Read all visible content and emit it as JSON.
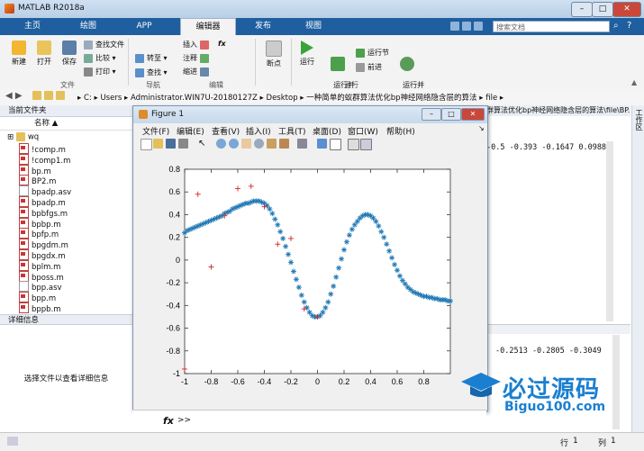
{
  "window": {
    "title": "MATLAB R2018a"
  },
  "tabs": [
    "主页",
    "绘图",
    "APP",
    "编辑器",
    "发布",
    "视图"
  ],
  "search": {
    "placeholder": "搜索文档"
  },
  "ribbon": {
    "file": {
      "new": "新建",
      "open": "打开",
      "save": "保存",
      "find_files": "查找文件",
      "compare": "比较",
      "print": "打印",
      "label": "文件"
    },
    "nav": {
      "insert": "插入",
      "comment": "注释",
      "indent": "缩进",
      "goto": "转至",
      "find": "查找",
      "label": "导航"
    },
    "edit": {
      "fx": "fx",
      "label": "编辑"
    },
    "breakpoints": {
      "breakpoint": "断点",
      "label": "断点"
    },
    "run": {
      "run": "运行",
      "run_advance": "运行并\n前进",
      "run_section": "运行节",
      "advance": "前进",
      "run_time": "运行并\n计时",
      "label": "运行"
    }
  },
  "address": {
    "path": [
      "C:",
      "Users",
      "Administrator.WIN7U-20180127Z",
      "Desktop",
      "一种简单的蚁群算法优化bp神经网络隐含层的算法",
      "file"
    ]
  },
  "left_panel": {
    "title": "当前文件夹",
    "column": "名称",
    "folder": "wq",
    "files": [
      "!comp.m",
      "!comp1.m",
      "bp.m",
      "BP2.m",
      "bpadp.asv",
      "bpadp.m",
      "bpbfgs.m",
      "bpbp.m",
      "bpfp.m",
      "bpgdm.m",
      "bpgdx.m",
      "bplm.m",
      "bposs.m",
      "bpp.asv",
      "bpp.m",
      "bppb.m"
    ],
    "file_types": [
      "m",
      "m",
      "m",
      "m",
      "asv",
      "m",
      "m",
      "m",
      "m",
      "m",
      "m",
      "m",
      "m",
      "asv",
      "m",
      "m"
    ],
    "details_title": "详细信息",
    "details_hint": "选择文件以查看详细信息"
  },
  "right_panel": {
    "header_path": "群算法优化bp神经网络隐含层的算法\\file\\BP...",
    "side_label": "工作区",
    "row1": "-0.5  -0.393  -0.1647  0.0988",
    "row2": "-0.2513    -0.2805    -0.3049"
  },
  "figure": {
    "title": "Figure 1",
    "menu": [
      "文件(F)",
      "编辑(E)",
      "查看(V)",
      "插入(I)",
      "工具(T)",
      "桌面(D)",
      "窗口(W)",
      "帮助(H)"
    ]
  },
  "command": {
    "prompt": ">>",
    "fx": "fx"
  },
  "status": {
    "row_label": "行",
    "row": "1",
    "col_label": "列",
    "col": "1"
  },
  "watermark": {
    "text": "必过源码",
    "url": "Biguo100.com"
  },
  "colors": {
    "accent": "#1f5f9f",
    "net": "#1f77b4",
    "target": "#d62728"
  },
  "chart_data": {
    "type": "scatter",
    "xlim": [
      -1,
      1
    ],
    "ylim": [
      -1,
      0.8
    ],
    "xticks": [
      "-1",
      "-0.8",
      "-0.6",
      "-0.4",
      "-0.2",
      "0",
      "0.2",
      "0.4",
      "0.6",
      "0.8"
    ],
    "yticks": [
      "0.8",
      "0.6",
      "0.4",
      "0.2",
      "0",
      "-0.2",
      "-0.4",
      "-0.6",
      "-0.8",
      "-1"
    ],
    "grid": false,
    "series": [
      {
        "marker": "*",
        "color": "#1f77b4",
        "x": [
          -1,
          -0.98,
          -0.96,
          -0.94,
          -0.92,
          -0.9,
          -0.88,
          -0.86,
          -0.84,
          -0.82,
          -0.8,
          -0.78,
          -0.76,
          -0.74,
          -0.72,
          -0.7,
          -0.68,
          -0.66,
          -0.64,
          -0.62,
          -0.6,
          -0.58,
          -0.56,
          -0.54,
          -0.52,
          -0.5,
          -0.48,
          -0.46,
          -0.44,
          -0.42,
          -0.4,
          -0.38,
          -0.36,
          -0.34,
          -0.32,
          -0.3,
          -0.28,
          -0.26,
          -0.24,
          -0.22,
          -0.2,
          -0.18,
          -0.16,
          -0.14,
          -0.12,
          -0.1,
          -0.08,
          -0.06,
          -0.04,
          -0.02,
          0,
          0.02,
          0.04,
          0.06,
          0.08,
          0.1,
          0.12,
          0.14,
          0.16,
          0.18,
          0.2,
          0.22,
          0.24,
          0.26,
          0.28,
          0.3,
          0.32,
          0.34,
          0.36,
          0.38,
          0.4,
          0.42,
          0.44,
          0.46,
          0.48,
          0.5,
          0.52,
          0.54,
          0.56,
          0.58,
          0.6,
          0.62,
          0.64,
          0.66,
          0.68,
          0.7,
          0.72,
          0.74,
          0.76,
          0.78,
          0.8,
          0.82,
          0.84,
          0.86,
          0.88,
          0.9,
          0.92,
          0.94,
          0.96,
          0.98,
          1
        ],
        "y": [
          0.24,
          0.26,
          0.27,
          0.28,
          0.29,
          0.3,
          0.31,
          0.32,
          0.33,
          0.34,
          0.35,
          0.36,
          0.37,
          0.38,
          0.39,
          0.41,
          0.42,
          0.43,
          0.45,
          0.46,
          0.47,
          0.48,
          0.49,
          0.5,
          0.5,
          0.51,
          0.52,
          0.52,
          0.52,
          0.51,
          0.5,
          0.48,
          0.45,
          0.41,
          0.36,
          0.31,
          0.25,
          0.19,
          0.12,
          0.05,
          -0.02,
          -0.1,
          -0.17,
          -0.24,
          -0.31,
          -0.37,
          -0.42,
          -0.46,
          -0.49,
          -0.5,
          -0.5,
          -0.49,
          -0.46,
          -0.42,
          -0.37,
          -0.3,
          -0.23,
          -0.15,
          -0.07,
          0.01,
          0.09,
          0.16,
          0.22,
          0.27,
          0.31,
          0.34,
          0.37,
          0.39,
          0.4,
          0.4,
          0.39,
          0.37,
          0.34,
          0.3,
          0.25,
          0.2,
          0.14,
          0.08,
          0.02,
          -0.04,
          -0.09,
          -0.14,
          -0.18,
          -0.21,
          -0.24,
          -0.26,
          -0.28,
          -0.29,
          -0.3,
          -0.31,
          -0.32,
          -0.32,
          -0.33,
          -0.33,
          -0.34,
          -0.34,
          -0.35,
          -0.35,
          -0.35,
          -0.36,
          -0.36
        ]
      },
      {
        "marker": "+",
        "color": "#d62728",
        "x": [
          -1,
          -0.9,
          -0.8,
          -0.7,
          -0.6,
          -0.5,
          -0.4,
          -0.3,
          -0.2,
          -0.1,
          0
        ],
        "y": [
          -0.96,
          0.58,
          -0.06,
          0.39,
          0.63,
          0.65,
          0.47,
          0.14,
          0.19,
          -0.43,
          -0.5
        ]
      }
    ]
  }
}
